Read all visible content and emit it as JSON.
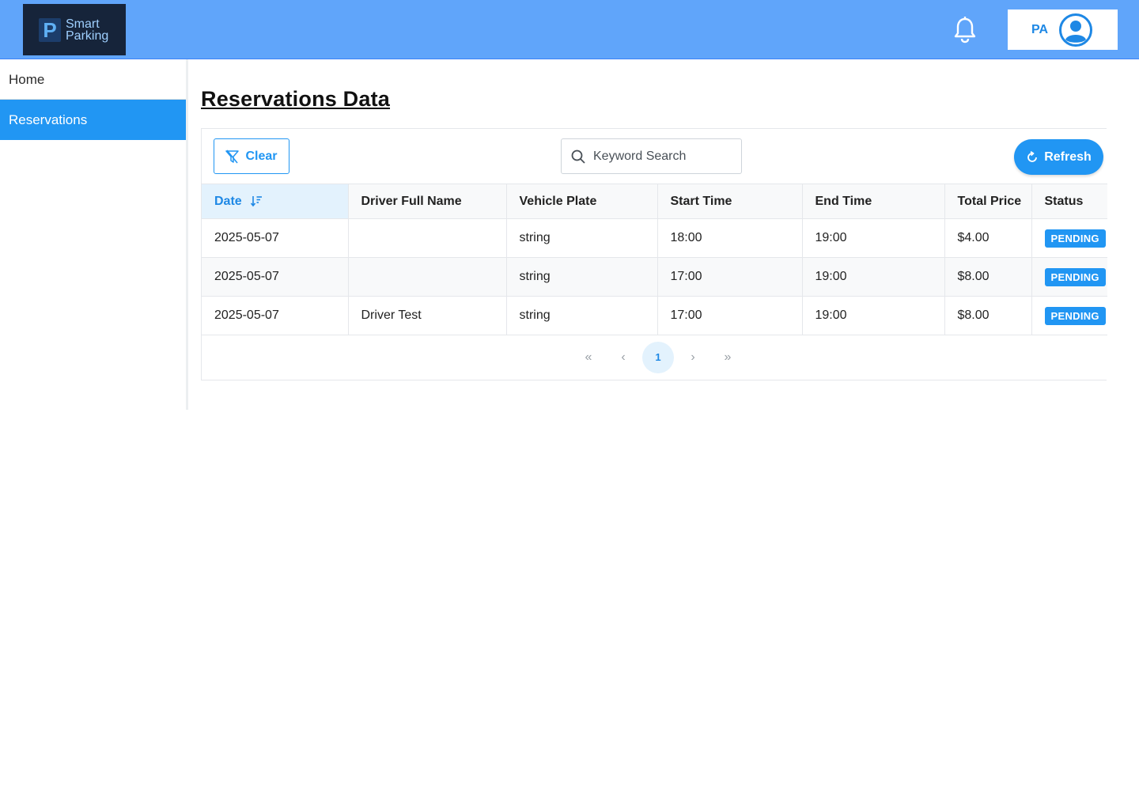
{
  "header": {
    "logo_letter": "P",
    "logo_line1": "Smart",
    "logo_line2": "Parking",
    "user_initials": "PA"
  },
  "sidebar": {
    "items": [
      {
        "label": "Home",
        "active": false
      },
      {
        "label": "Reservations",
        "active": true
      }
    ]
  },
  "page": {
    "title": "Reservations Data"
  },
  "toolbar": {
    "clear_label": "Clear",
    "search_placeholder": "Keyword Search",
    "refresh_label": "Refresh"
  },
  "table": {
    "columns": [
      "Date",
      "Driver Full Name",
      "Vehicle Plate",
      "Start Time",
      "End Time",
      "Total Price",
      "Status"
    ],
    "rows": [
      {
        "date": "2025-05-07",
        "driver": "",
        "plate": "string",
        "start": "18:00",
        "end": "19:00",
        "price": "$4.00",
        "status": "PENDING"
      },
      {
        "date": "2025-05-07",
        "driver": "",
        "plate": "string",
        "start": "17:00",
        "end": "19:00",
        "price": "$8.00",
        "status": "PENDING"
      },
      {
        "date": "2025-05-07",
        "driver": "Driver Test",
        "plate": "string",
        "start": "17:00",
        "end": "19:00",
        "price": "$8.00",
        "status": "PENDING"
      }
    ]
  },
  "pagination": {
    "current_page": "1",
    "first_icon": "«",
    "prev_icon": "‹",
    "next_icon": "›",
    "last_icon": "»"
  },
  "colors": {
    "header_bg": "#60a5fa",
    "accent": "#2196f3",
    "logo_bg": "#16243a"
  }
}
